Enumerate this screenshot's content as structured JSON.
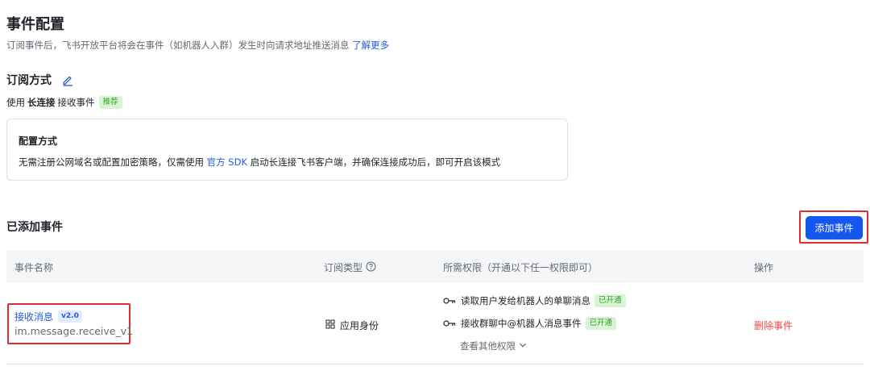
{
  "header": {
    "title": "事件配置",
    "subtitle": "订阅事件后，飞书开放平台将会在事件（如机器人入群）发生时向请求地址推送消息",
    "learn_more": "了解更多"
  },
  "subscription": {
    "title": "订阅方式",
    "prefix": "使用",
    "method": "长连接",
    "suffix": "接收事件",
    "badge": "推荐"
  },
  "config": {
    "title": "配置方式",
    "desc_before": "无需注册公网域名或配置加密策略，仅需使用",
    "sdk_link": "官方 SDK",
    "desc_after": "启动长连接飞书客户端，并确保连接成功后，即可开启该模式"
  },
  "events": {
    "title": "已添加事件",
    "add_button": "添加事件",
    "columns": [
      "事件名称",
      "订阅类型",
      "所需权限（开通以下任一权限即可）",
      "操作"
    ],
    "rows": [
      {
        "name": "接收消息",
        "version": "v2.0",
        "id": "im.message.receive_v1",
        "type": "应用身份",
        "permissions": [
          {
            "label": "读取用户发给机器人的单聊消息",
            "status": "已开通"
          },
          {
            "label": "接收群聊中@机器人消息事件",
            "status": "已开通"
          }
        ],
        "more": "查看其他权限",
        "action": "删除事件"
      }
    ]
  },
  "colors": {
    "primary": "#1456f0",
    "link": "#245bdb",
    "danger": "#f54a45",
    "success": "#2ea121",
    "highlight_frame": "#e02d2d"
  }
}
